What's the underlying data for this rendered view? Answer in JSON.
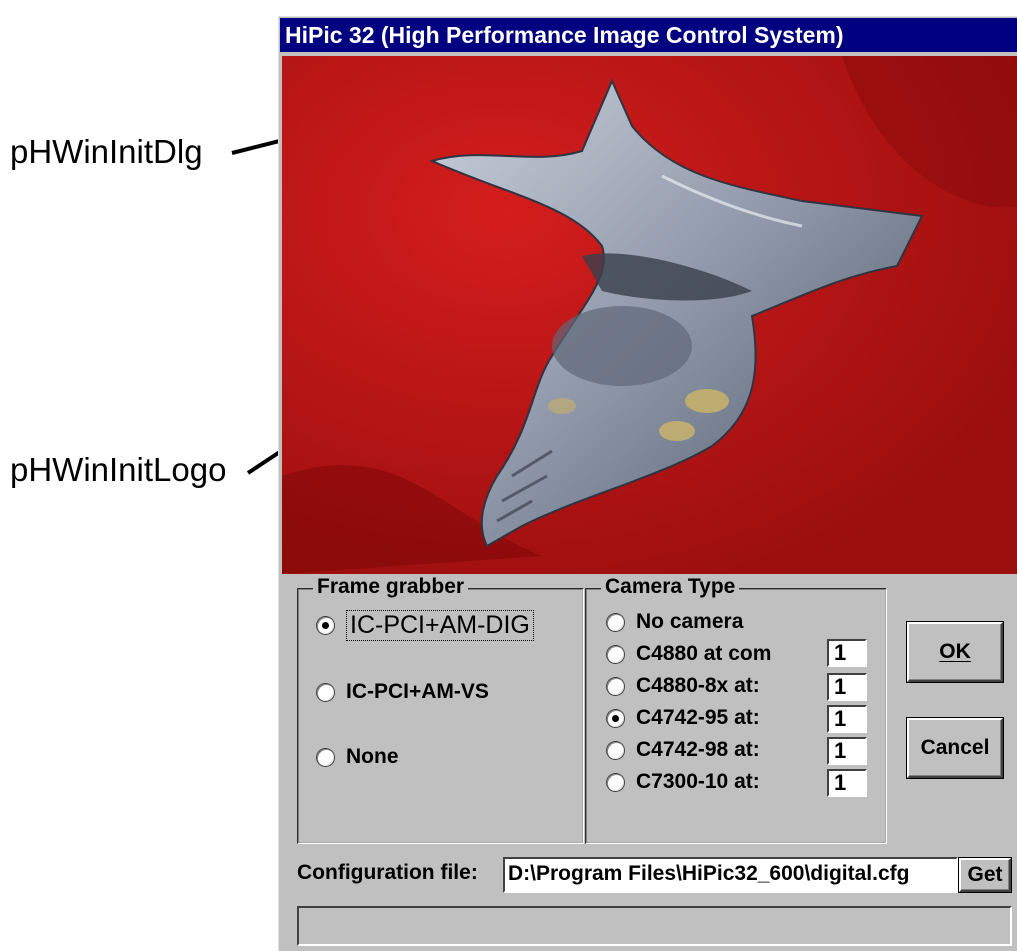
{
  "annotations": {
    "dialog_label": "pHWinInitDlg",
    "logo_label": "pHWinInitLogo"
  },
  "window": {
    "title": "HiPic 32 (High Performance Image Control System)"
  },
  "frame_grabber": {
    "title": "Frame grabber",
    "options": [
      "IC-PCI+AM-DIG",
      "IC-PCI+AM-VS",
      "None"
    ],
    "selected": "IC-PCI+AM-DIG"
  },
  "camera_type": {
    "title": "Camera Type",
    "options": [
      "No camera",
      "C4880 at com",
      "C4880-8x at:",
      "C4742-95 at:",
      "C4742-98 at:",
      "C7300-10 at:"
    ],
    "ports": [
      "1",
      "1",
      "1",
      "1",
      "1"
    ],
    "selected": "C4742-95 at:"
  },
  "buttons": {
    "ok": "OK",
    "cancel": "Cancel",
    "get": "Get"
  },
  "config": {
    "label": "Configuration file:",
    "value": "D:\\Program Files\\HiPic32_600\\digital.cfg"
  },
  "colors": {
    "titlebar": "#000080",
    "dialog_bg": "#c0c0c0",
    "logo_bg": "#b01010"
  }
}
